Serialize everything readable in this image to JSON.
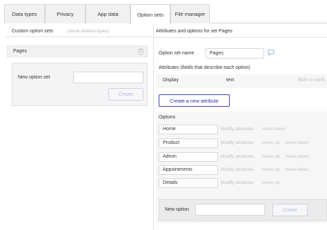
{
  "tabs": [
    {
      "label": "Data types",
      "active": false
    },
    {
      "label": "Privacy",
      "active": false
    },
    {
      "label": "App data",
      "active": false
    },
    {
      "label": "Option sets",
      "active": true
    },
    {
      "label": "File manager",
      "active": false
    }
  ],
  "left": {
    "title": "Custom option sets",
    "show_deleted": "(show deleted types)",
    "option_sets": [
      {
        "label": "Pages"
      }
    ],
    "new_option_set": {
      "label": "New option set",
      "value": "",
      "placeholder": "",
      "create_label": "Create"
    }
  },
  "right": {
    "title": "Attributes and options for set Pages",
    "name_label": "Option set name",
    "name_value": "Pages",
    "attributes_heading": "Attributes (fields that describe each option)",
    "attributes": [
      {
        "name": "Display",
        "type": "text",
        "note": "Built-in attrib"
      }
    ],
    "create_attribute_label": "Create a new attribute",
    "options_heading": "Options",
    "options": [
      {
        "value": "Home",
        "actions": [
          "Modify attributes",
          "move down"
        ]
      },
      {
        "value": "Product",
        "actions": [
          "Modify attributes",
          "move up",
          "move down"
        ]
      },
      {
        "value": "Admin",
        "actions": [
          "Modify attributes",
          "move up",
          "move down"
        ]
      },
      {
        "value": "Appointments",
        "actions": [
          "Modify attributes",
          "move up",
          "move down"
        ]
      },
      {
        "value": "Details",
        "actions": [
          "Modify attributes",
          "move up"
        ]
      }
    ],
    "new_option": {
      "label": "New option",
      "value": "",
      "create_label": "Create"
    }
  },
  "colors": {
    "accent": "#3d41b5",
    "accent_text": "#2d31a6",
    "disabled_border": "#cfd1ec",
    "panel_bg": "#f6f6f6"
  },
  "icons": {
    "trash": "trash-icon",
    "comment": "comment-icon"
  }
}
